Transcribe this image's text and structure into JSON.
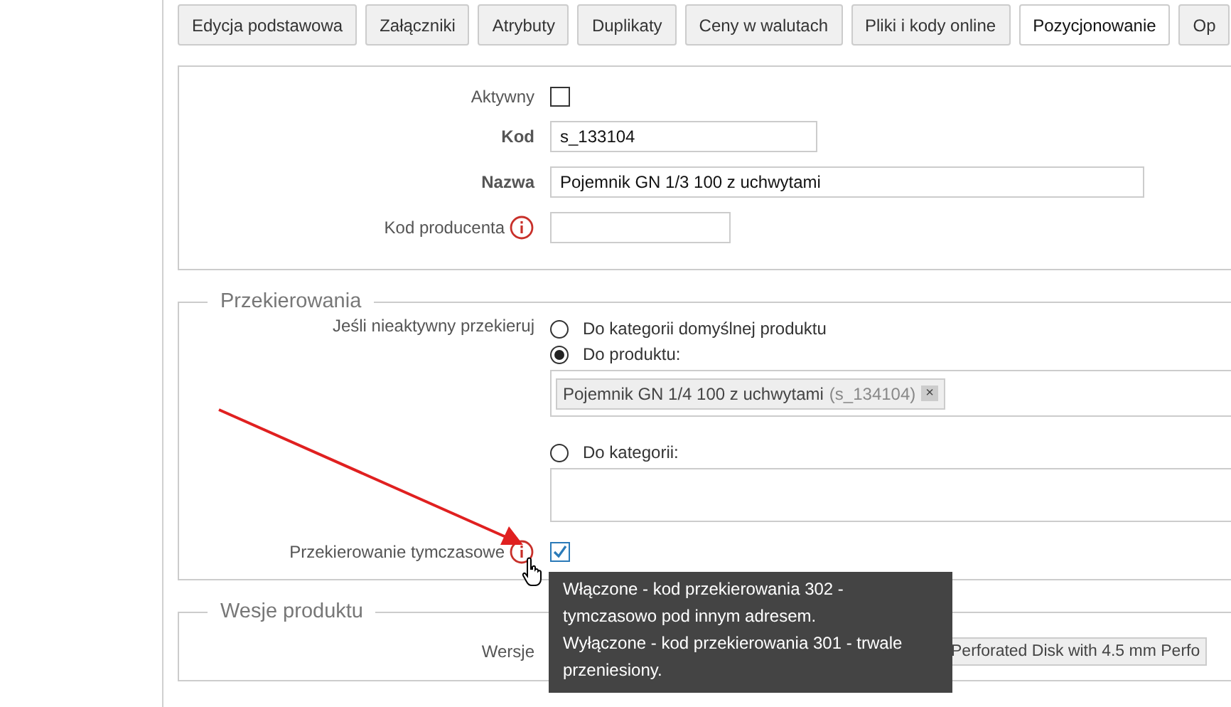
{
  "tabs": [
    {
      "label": "Edycja podstawowa",
      "selected": false
    },
    {
      "label": "Załączniki",
      "selected": false
    },
    {
      "label": "Atrybuty",
      "selected": false
    },
    {
      "label": "Duplikaty",
      "selected": false
    },
    {
      "label": "Ceny w walutach",
      "selected": false
    },
    {
      "label": "Pliki i kody online",
      "selected": false
    },
    {
      "label": "Pozycjonowanie",
      "selected": true
    },
    {
      "label": "Op",
      "selected": false
    }
  ],
  "basic": {
    "active": {
      "label": "Aktywny",
      "checked": false
    },
    "code": {
      "label": "Kod",
      "value": "s_133104"
    },
    "name": {
      "label": "Nazwa",
      "value": "Pojemnik GN 1/3 100 z uchwytami"
    },
    "producer_code": {
      "label": "Kod producenta"
    }
  },
  "redirects": {
    "legend": "Przekierowania",
    "label": "Jeśli nieaktywny przekieruj",
    "options": [
      {
        "label": "Do kategorii domyślnej produktu",
        "selected": false,
        "kind": "plain"
      },
      {
        "label": "Do produktu:",
        "selected": true,
        "kind": "field",
        "tags": [
          {
            "name": "Pojemnik GN 1/4 100 z uchwytami",
            "code": "(s_134104)",
            "remove": "×"
          }
        ]
      },
      {
        "label": "Do kategorii:",
        "selected": false,
        "kind": "field"
      }
    ],
    "temporary": {
      "label": "Przekierowanie tymczasowe",
      "checked": true
    }
  },
  "versions": {
    "legend": "Wesje produktu",
    "label": "Wersje",
    "tags": [
      {
        "name": "Perforated Disk with 4.5 mm Perfo"
      }
    ]
  },
  "tooltip": {
    "lines": [
      "Włączone - kod przekierowania 302 - tymczasowo pod innym adresem.",
      "Wyłączone - kod przekierowania 301 - trwale przeniesiony."
    ]
  }
}
